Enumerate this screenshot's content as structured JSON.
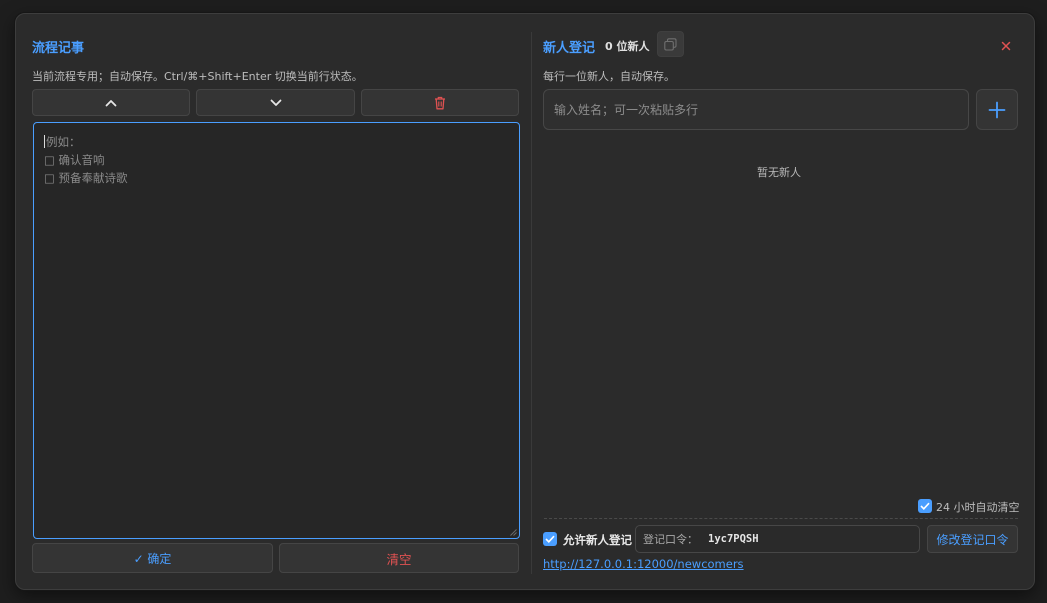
{
  "left": {
    "title": "流程记事",
    "hint": "当前流程专用；自动保存。Ctrl/⌘+Shift+Enter 切换当前行状态。",
    "toolbar": {
      "up_icon": "chevron-up-icon",
      "down_icon": "chevron-down-icon",
      "delete_icon": "trash-icon"
    },
    "textarea": {
      "placeholder_lines": [
        "例如：",
        "□ 确认音响",
        "□ 预备奉献诗歌"
      ]
    },
    "confirm_label": "✓ 确定",
    "clear_label": "清空"
  },
  "right": {
    "title": "新人登记",
    "count": "0 位新人",
    "copy_icon": "copy-icon",
    "close_icon": "close-icon",
    "hint": "每行一位新人，自动保存。",
    "name_input": {
      "placeholder": "输入姓名；可一次粘贴多行"
    },
    "add_icon": "plus-icon",
    "empty_text": "暂无新人",
    "auto_clear": {
      "label": "24 小时自动清空",
      "checked": true
    },
    "allow": {
      "label": "允许新人登记",
      "checked": true
    },
    "code": {
      "label": "登记口令：",
      "value": "1yc7PQSH"
    },
    "change_code_label": "修改登记口令",
    "url": "http://127.0.0.1:12000/newcomers"
  },
  "colors": {
    "accent": "#4a9eff",
    "danger": "#e05252",
    "panel": "#2b2b2b"
  }
}
